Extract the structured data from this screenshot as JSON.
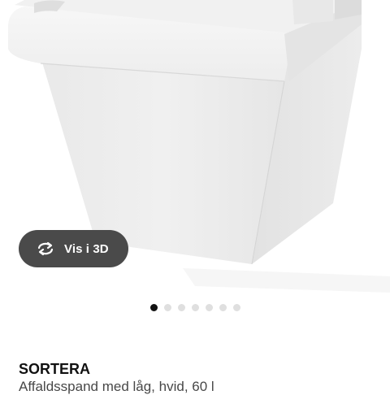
{
  "product": {
    "name": "SORTERA",
    "description": "Affaldsspand med låg, hvid, 60 l"
  },
  "view_3d": {
    "label": "Vis i 3D",
    "icon": "rotate-3d-icon"
  },
  "carousel": {
    "total": 7,
    "active_index": 0
  },
  "colors": {
    "button_bg": "#4a4a4a",
    "dot_active": "#111111",
    "dot_inactive": "#dfdfdf"
  }
}
